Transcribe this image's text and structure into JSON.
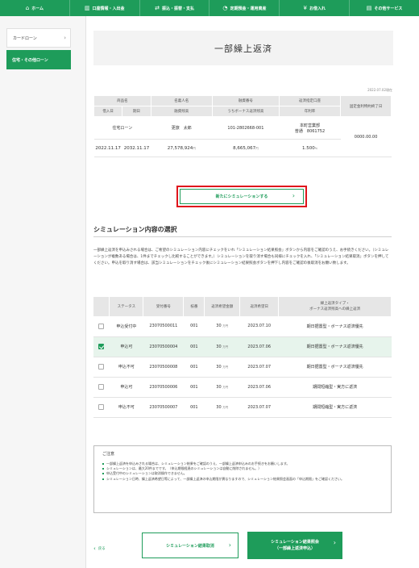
{
  "nav": [
    {
      "icon": "⌂",
      "label": "ホーム"
    },
    {
      "icon": "▥",
      "label": "口座情報・入出金"
    },
    {
      "icon": "⇄",
      "label": "振込・振替・支払"
    },
    {
      "icon": "◔",
      "label": "定期預金・運用資産"
    },
    {
      "icon": "¥",
      "label": "お借入れ"
    },
    {
      "icon": "▤",
      "label": "その他サービス"
    }
  ],
  "sidebar": {
    "items": [
      {
        "label": "カードローン",
        "chevron": "›"
      },
      {
        "label": "住宅・その他ローン"
      }
    ]
  },
  "page_title": "一部繰上返済",
  "as_of": "2022.07.02現在",
  "info_table": {
    "headers_row1": [
      "商品名",
      "名義人名",
      "融資番号",
      "返済指定口座",
      "固定金利特約終了日"
    ],
    "headers_row2": [
      "借入日",
      "期日",
      "融資残高",
      "うちボーナス返済残高",
      "年利率"
    ],
    "product": "住宅ローン",
    "holder": "更旅　太郎",
    "loan_no": "101-2802668-001",
    "account_line1": "本町営業部",
    "account_line2": "普通　8061752",
    "fixed_end": "0000.00.00",
    "borrow_date": "2022.11.17",
    "due_date": "2032.11.17",
    "balance": "27,578,924",
    "bonus_balance": "8,665,067",
    "rate": "1.500",
    "yen": "円",
    "percent": "%"
  },
  "new_sim_button": {
    "label": "新たにシミュレーションする",
    "arrow": "›"
  },
  "section": {
    "title": "シミュレーション内容の選択",
    "desc": "一部繰上返済を申込みされる場合は、ご希望のシミュレーション内容にチェックをいれ「シミュレーション結果照会」ボタンから内容をご確認のうえ、お手続きください。（シミュレーションが複数ある場合は、1件までチェックし比較することができます。）シミュレーションを取り消す場合も同様にチェックを入れ、「シミュレーション結果取消」ボタンを押してください。申込を取り消す場合は、該当シミュレーションをチェック後にシミュレーション結果照会ボタンを押下し内容をご確認の後取消をお願い致します。"
  },
  "sim_table": {
    "headers": [
      "",
      "ステータス",
      "受付番号",
      "枝番",
      "返済希望金額",
      "返済希望日",
      "繰上返済タイプ・\nボーナス返済残高への繰上返済"
    ],
    "unit": "万円",
    "rows": [
      {
        "checked": false,
        "status": "申込受付中",
        "no": "23070500011",
        "branch": "001",
        "amount": "30",
        "date": "2023.07.10",
        "type": "期日据置型・ボーナス返済優先"
      },
      {
        "checked": true,
        "status": "申込可",
        "no": "23070500004",
        "branch": "001",
        "amount": "30",
        "date": "2023.07.06",
        "type": "期日据置型・ボーナス返済優先"
      },
      {
        "checked": false,
        "status": "申込不可",
        "no": "23070500008",
        "branch": "001",
        "amount": "30",
        "date": "2023.07.07",
        "type": "期日据置型・ボーナス返済優先"
      },
      {
        "checked": false,
        "status": "申込可",
        "no": "23070500006",
        "branch": "001",
        "amount": "30",
        "date": "2023.07.06",
        "type": "期間短縮型・実方に返済"
      },
      {
        "checked": false,
        "status": "申込不可",
        "no": "23070500007",
        "branch": "001",
        "amount": "30",
        "date": "2023.07.07",
        "type": "期間短縮型・実方に返済"
      }
    ]
  },
  "notes": {
    "title": "ご注意",
    "items": [
      "一部繰上返済を申込みされる場合は、シミュレーション結果をご確認のうえ、一部繰上返済申込みのお手続きをお願いします。",
      "シミュレーションは、最大20件までです。（申込期限経過のシミュレーションは自動に削除されません。）",
      "申込受付中のシミュレーションは取消操作できません。",
      "シミュレーション日時、繰上返済希望日等によって、一部繰上返済の申込期限が異なりますので、シミュレーション結果照会画面の「申込期限」をご確認ください。"
    ]
  },
  "back_label": "戻る",
  "cancel_button": {
    "label": "シミュレーション結果取消",
    "arrow": "›"
  },
  "confirm_button": {
    "label": "シミュレーション結果照会\n（一部繰上返済申込）",
    "arrow": "›"
  }
}
